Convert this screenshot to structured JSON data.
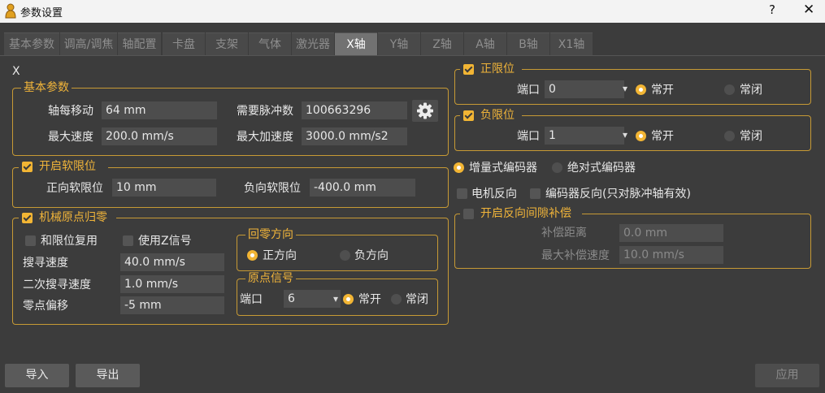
{
  "window": {
    "title": "参数设置",
    "help": "?",
    "close": "✕"
  },
  "tabs": [
    "基本参数",
    "调高/调焦",
    "轴配置",
    "卡盘",
    "支架",
    "气体",
    "激光器",
    "X轴",
    "Y轴",
    "Z轴",
    "A轴",
    "B轴",
    "X1轴"
  ],
  "axis_name": "X",
  "basic": {
    "legend": "基本参数",
    "move_label": "轴每移动",
    "move_value": "64 mm",
    "pulse_label": "需要脉冲数",
    "pulse_value": "100663296",
    "speed_label": "最大速度",
    "speed_value": "200.0 mm/s",
    "accel_label": "最大加速度",
    "accel_value": "3000.0 mm/s2"
  },
  "soft_limit": {
    "legend": "开启软限位",
    "checked": true,
    "pos_label": "正向软限位",
    "pos_value": "10 mm",
    "neg_label": "负向软限位",
    "neg_value": "-400.0 mm"
  },
  "homing": {
    "legend": "机械原点归零",
    "checked": true,
    "reuse_limit": "和限位复用",
    "use_z": "使用Z信号",
    "search_label": "搜寻速度",
    "search_value": "40.0 mm/s",
    "second_label": "二次搜寻速度",
    "second_value": "1.0 mm/s",
    "offset_label": "零点偏移",
    "offset_value": "-5 mm",
    "direction": {
      "legend": "回零方向",
      "pos": "正方向",
      "neg": "负方向"
    },
    "signal": {
      "legend": "原点信号",
      "port_label": "端口",
      "port_value": "6",
      "no": "常开",
      "nc": "常闭"
    }
  },
  "pos_limit": {
    "legend": "正限位",
    "port_label": "端口",
    "port_value": "0",
    "no": "常开",
    "nc": "常闭"
  },
  "neg_limit": {
    "legend": "负限位",
    "port_label": "端口",
    "port_value": "1",
    "no": "常开",
    "nc": "常闭"
  },
  "encoder": {
    "incremental": "增量式编码器",
    "absolute": "绝对式编码器",
    "motor_reverse": "电机反向",
    "encoder_reverse": "编码器反向(只对脉冲轴有效)"
  },
  "backlash": {
    "legend": "开启反向间隙补偿",
    "dist_label": "补偿距离",
    "dist_value": "0.0 mm",
    "speed_label": "最大补偿速度",
    "speed_value": "10.0 mm/s"
  },
  "buttons": {
    "import": "导入",
    "export": "导出",
    "apply": "应用"
  },
  "colors": {
    "accent": "#f2b534",
    "background": "#3c3c3c",
    "tab_active": "#727272"
  }
}
